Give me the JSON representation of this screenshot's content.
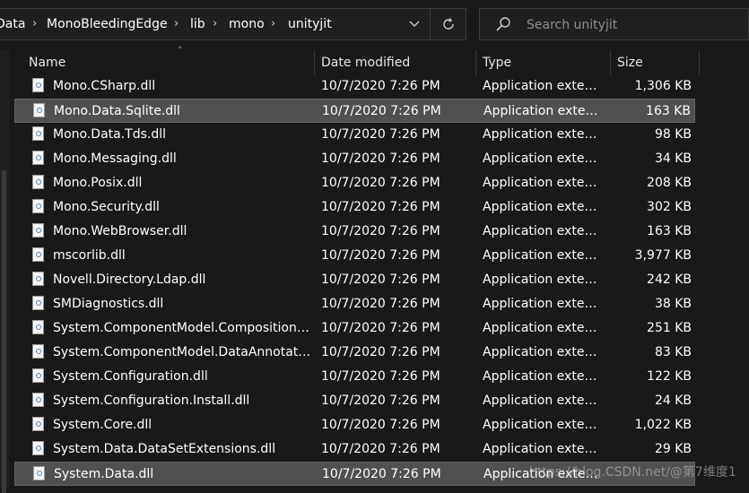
{
  "breadcrumb": [
    "Data",
    "MonoBleedingEdge",
    "lib",
    "mono",
    "unityjit"
  ],
  "search": {
    "placeholder": "Search unityjit"
  },
  "columns": {
    "name": "Name",
    "date": "Date modified",
    "type": "Type",
    "size": "Size"
  },
  "rows": [
    {
      "name": "Mono.CSharp.dll",
      "date": "10/7/2020 7:26 PM",
      "type": "Application extens...",
      "size": "1,306 KB",
      "selected": false
    },
    {
      "name": "Mono.Data.Sqlite.dll",
      "date": "10/7/2020 7:26 PM",
      "type": "Application extens...",
      "size": "163 KB",
      "selected": true
    },
    {
      "name": "Mono.Data.Tds.dll",
      "date": "10/7/2020 7:26 PM",
      "type": "Application extens...",
      "size": "98 KB",
      "selected": false
    },
    {
      "name": "Mono.Messaging.dll",
      "date": "10/7/2020 7:26 PM",
      "type": "Application extens...",
      "size": "34 KB",
      "selected": false
    },
    {
      "name": "Mono.Posix.dll",
      "date": "10/7/2020 7:26 PM",
      "type": "Application extens...",
      "size": "208 KB",
      "selected": false
    },
    {
      "name": "Mono.Security.dll",
      "date": "10/7/2020 7:26 PM",
      "type": "Application extens...",
      "size": "302 KB",
      "selected": false
    },
    {
      "name": "Mono.WebBrowser.dll",
      "date": "10/7/2020 7:26 PM",
      "type": "Application extens...",
      "size": "163 KB",
      "selected": false
    },
    {
      "name": "mscorlib.dll",
      "date": "10/7/2020 7:26 PM",
      "type": "Application extens...",
      "size": "3,977 KB",
      "selected": false
    },
    {
      "name": "Novell.Directory.Ldap.dll",
      "date": "10/7/2020 7:26 PM",
      "type": "Application extens...",
      "size": "242 KB",
      "selected": false
    },
    {
      "name": "SMDiagnostics.dll",
      "date": "10/7/2020 7:26 PM",
      "type": "Application extens...",
      "size": "38 KB",
      "selected": false
    },
    {
      "name": "System.ComponentModel.Composition.dll",
      "date": "10/7/2020 7:26 PM",
      "type": "Application extens...",
      "size": "251 KB",
      "selected": false
    },
    {
      "name": "System.ComponentModel.DataAnnotatio...",
      "date": "10/7/2020 7:26 PM",
      "type": "Application extens...",
      "size": "83 KB",
      "selected": false
    },
    {
      "name": "System.Configuration.dll",
      "date": "10/7/2020 7:26 PM",
      "type": "Application extens...",
      "size": "122 KB",
      "selected": false
    },
    {
      "name": "System.Configuration.Install.dll",
      "date": "10/7/2020 7:26 PM",
      "type": "Application extens...",
      "size": "24 KB",
      "selected": false
    },
    {
      "name": "System.Core.dll",
      "date": "10/7/2020 7:26 PM",
      "type": "Application extens...",
      "size": "1,022 KB",
      "selected": false
    },
    {
      "name": "System.Data.DataSetExtensions.dll",
      "date": "10/7/2020 7:26 PM",
      "type": "Application extens...",
      "size": "29 KB",
      "selected": false
    },
    {
      "name": "System.Data.dll",
      "date": "10/7/2020 7:26 PM",
      "type": "Application extens...",
      "size": "",
      "selected": true
    }
  ],
  "watermark": "https://blog.CSDN.net/@第7维度1",
  "colors": {
    "background": "#191919",
    "selection": "#505050",
    "text": "#ffffff"
  }
}
